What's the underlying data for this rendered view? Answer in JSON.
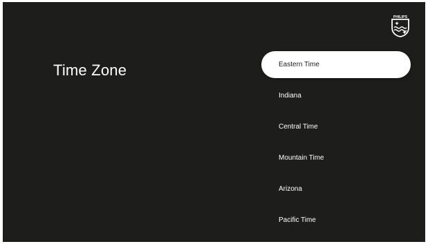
{
  "brand": {
    "name": "PHILIPS",
    "icon": "philips-shield-icon"
  },
  "page": {
    "title": "Time Zone"
  },
  "zones": [
    {
      "label": "Eastern Time",
      "selected": true
    },
    {
      "label": "Indiana",
      "selected": false
    },
    {
      "label": "Central Time",
      "selected": false
    },
    {
      "label": "Mountain Time",
      "selected": false
    },
    {
      "label": "Arizona",
      "selected": false
    },
    {
      "label": "Pacific Time",
      "selected": false
    }
  ],
  "colors": {
    "background": "#1d1d1b",
    "text": "#ffffff",
    "selected_background": "#ffffff",
    "selected_text": "#1d1d1b"
  }
}
